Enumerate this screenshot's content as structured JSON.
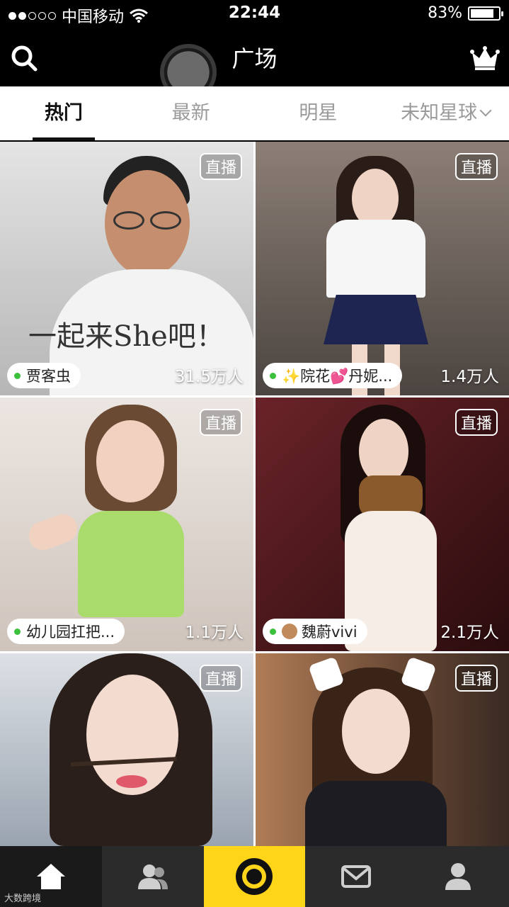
{
  "status_bar": {
    "carrier": "中国移动",
    "time": "22:44",
    "battery": "83%",
    "battery_level": 0.83
  },
  "header": {
    "title": "广场",
    "search_icon": "search-icon",
    "crown_icon": "crown-icon",
    "record_icon": "record-button-icon"
  },
  "tabs": [
    {
      "label": "热门",
      "active": true
    },
    {
      "label": "最新",
      "active": false
    },
    {
      "label": "明星",
      "active": false
    },
    {
      "label": "未知星球",
      "active": false
    }
  ],
  "cards": [
    {
      "badge": "直播",
      "name": "贾客虫",
      "viewers": "31.5万人",
      "poster_text": "一起来She吧！",
      "colors": [
        "#d9d9d9",
        "#a8a8a8"
      ]
    },
    {
      "badge": "直播",
      "name": "✨院花💕丹妮...",
      "viewers": "1.4万人",
      "colors": [
        "#8c7f76",
        "#4b4440"
      ]
    },
    {
      "badge": "直播",
      "name": "幼儿园扛把...",
      "viewers": "1.1万人",
      "colors": [
        "#e7e0dc",
        "#c9bdb5"
      ]
    },
    {
      "badge": "直播",
      "name": "魏蔚vivi",
      "viewers": "2.1万人",
      "colors": [
        "#5a1e22",
        "#2a0c0e"
      ]
    },
    {
      "badge": "直播",
      "name": "",
      "viewers": "",
      "colors": [
        "#cfd4da",
        "#8d97a3"
      ]
    },
    {
      "badge": "直播",
      "name": "",
      "viewers": "",
      "colors": [
        "#8a5c3e",
        "#3a2a22"
      ]
    }
  ],
  "bottom_nav": [
    {
      "icon": "home-icon"
    },
    {
      "icon": "friends-icon"
    },
    {
      "icon": "live-camera-icon"
    },
    {
      "icon": "message-icon"
    },
    {
      "icon": "profile-icon"
    }
  ],
  "watermark": "大数跨境"
}
